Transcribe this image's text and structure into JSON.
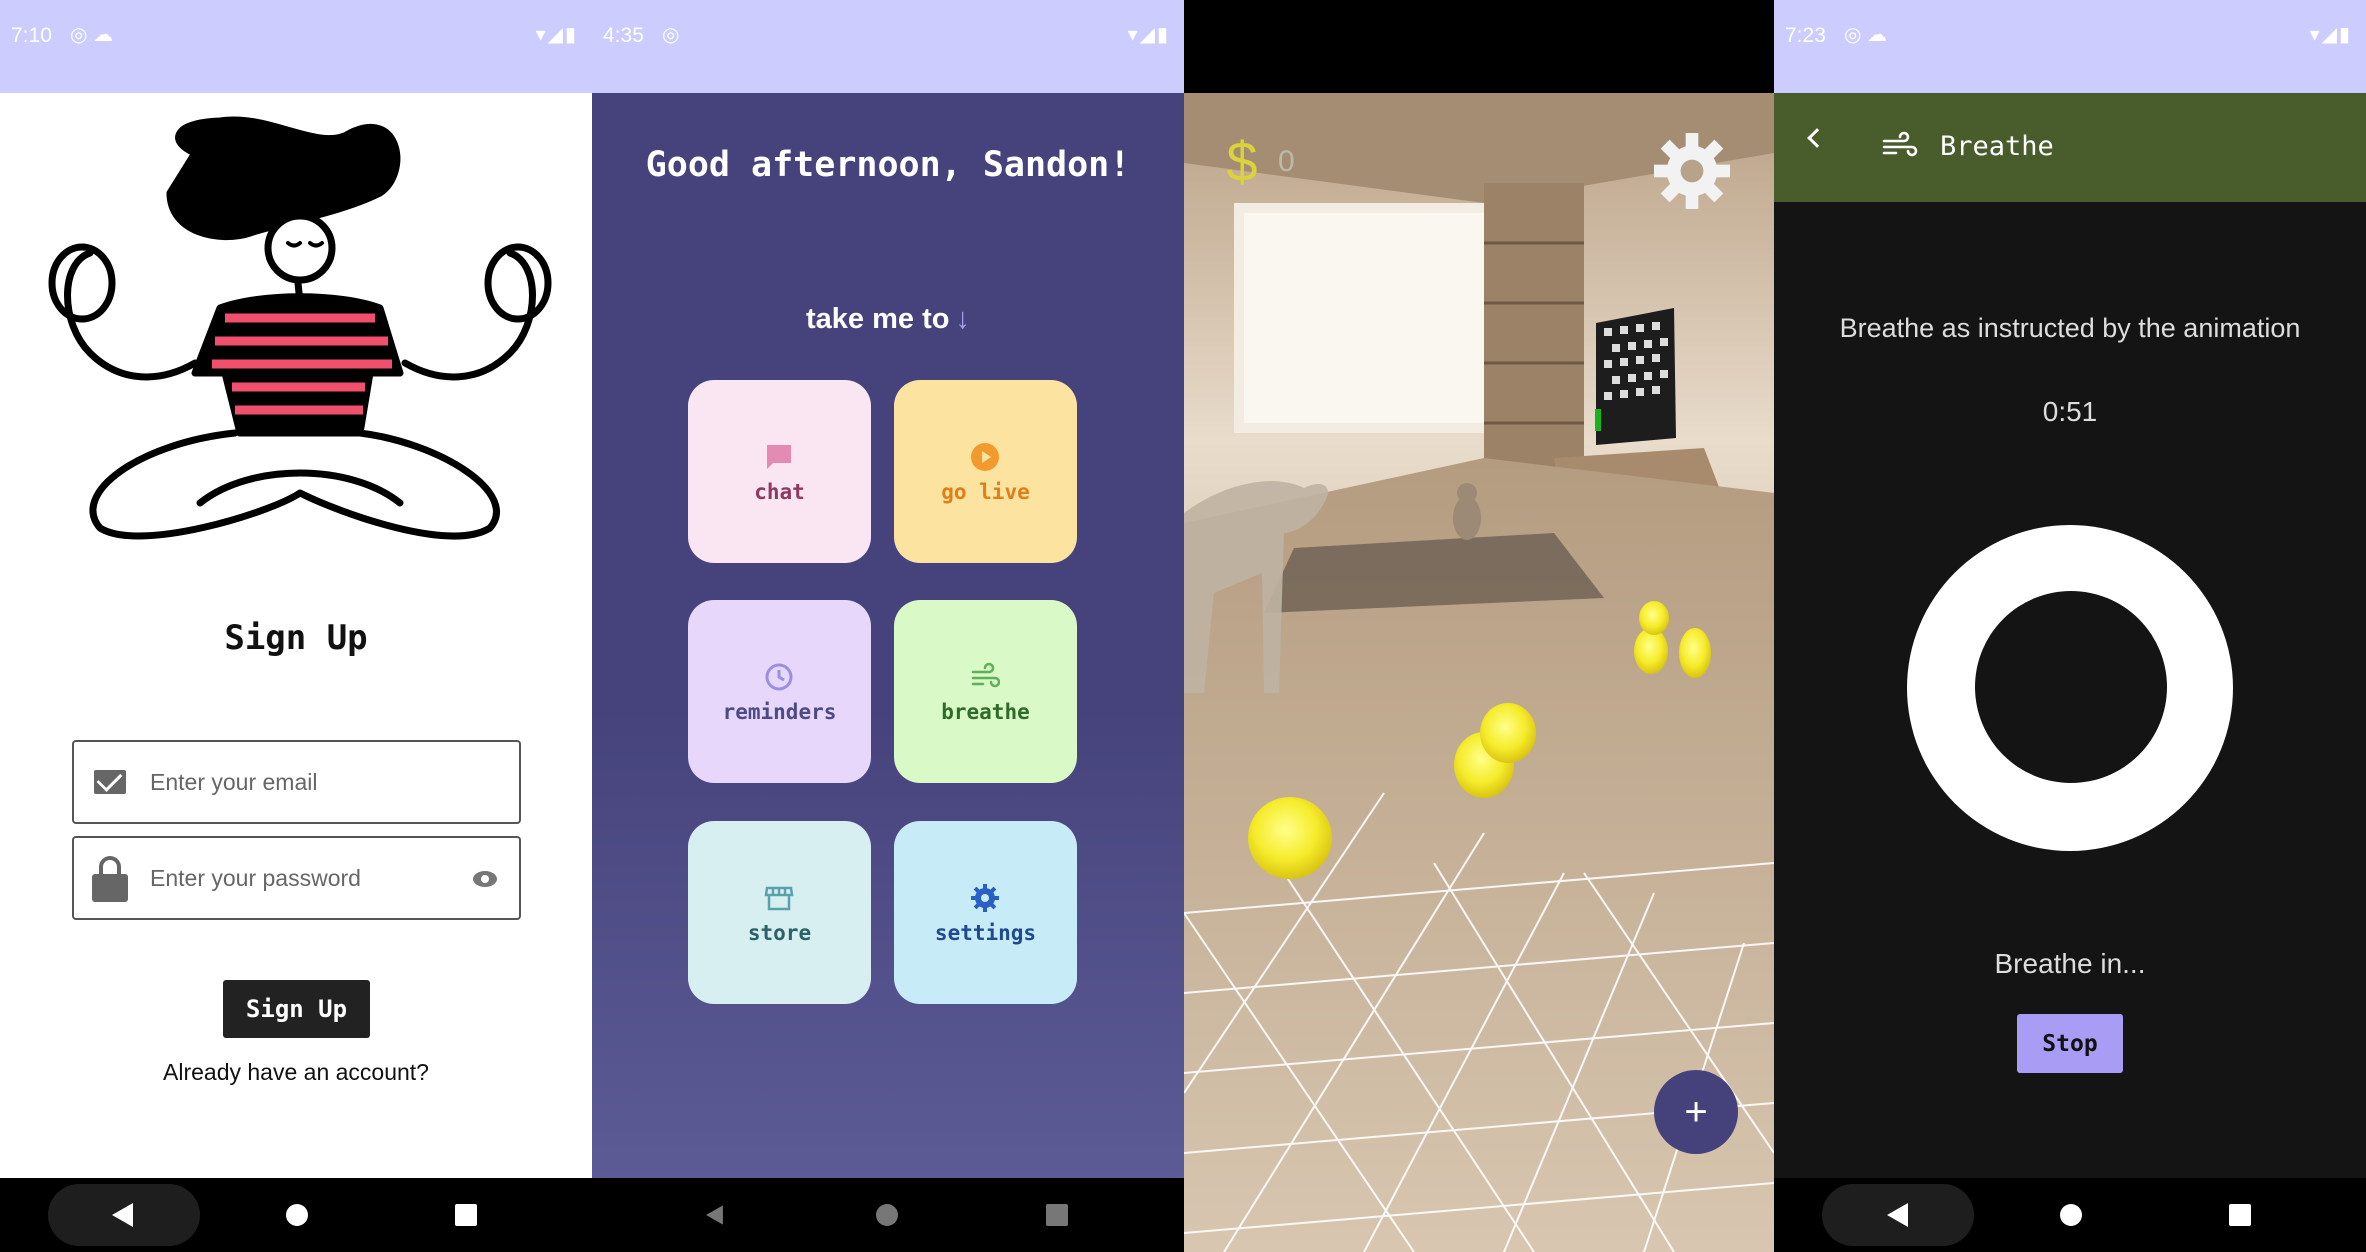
{
  "screen1": {
    "status_time": "7:10",
    "title": "Sign Up",
    "email_placeholder": "Enter your email",
    "password_placeholder": "Enter your password",
    "signup_button": "Sign Up",
    "already_link": "Already have an account?"
  },
  "screen2": {
    "status_time": "4:35",
    "greeting": "Good afternoon, Sandon!",
    "take_me_to": "take me to",
    "tiles": [
      {
        "label": "chat",
        "icon": "chat-bubble-icon",
        "bg": "#f9e6f2",
        "color": "#8c3a63"
      },
      {
        "label": "go live",
        "icon": "play-circle-icon",
        "bg": "#fde3a0",
        "color": "#e07e18"
      },
      {
        "label": "reminders",
        "icon": "clock-icon",
        "bg": "#e7d8fb",
        "color": "#4d4a86"
      },
      {
        "label": "breathe",
        "icon": "wind-icon",
        "bg": "#d9f9c6",
        "color": "#2e6b2a"
      },
      {
        "label": "store",
        "icon": "store-icon",
        "bg": "#d7eff0",
        "color": "#2b6168"
      },
      {
        "label": "settings",
        "icon": "gear-icon",
        "bg": "#c8ecf7",
        "color": "#1f4a92"
      }
    ]
  },
  "screen3": {
    "coin_count": "0",
    "fab_label": "+"
  },
  "screen4": {
    "status_time": "7:23",
    "title": "Breathe",
    "instruction": "Breathe as instructed by the animation",
    "timer": "0:51",
    "phase": "Breathe in...",
    "stop_button": "Stop"
  }
}
